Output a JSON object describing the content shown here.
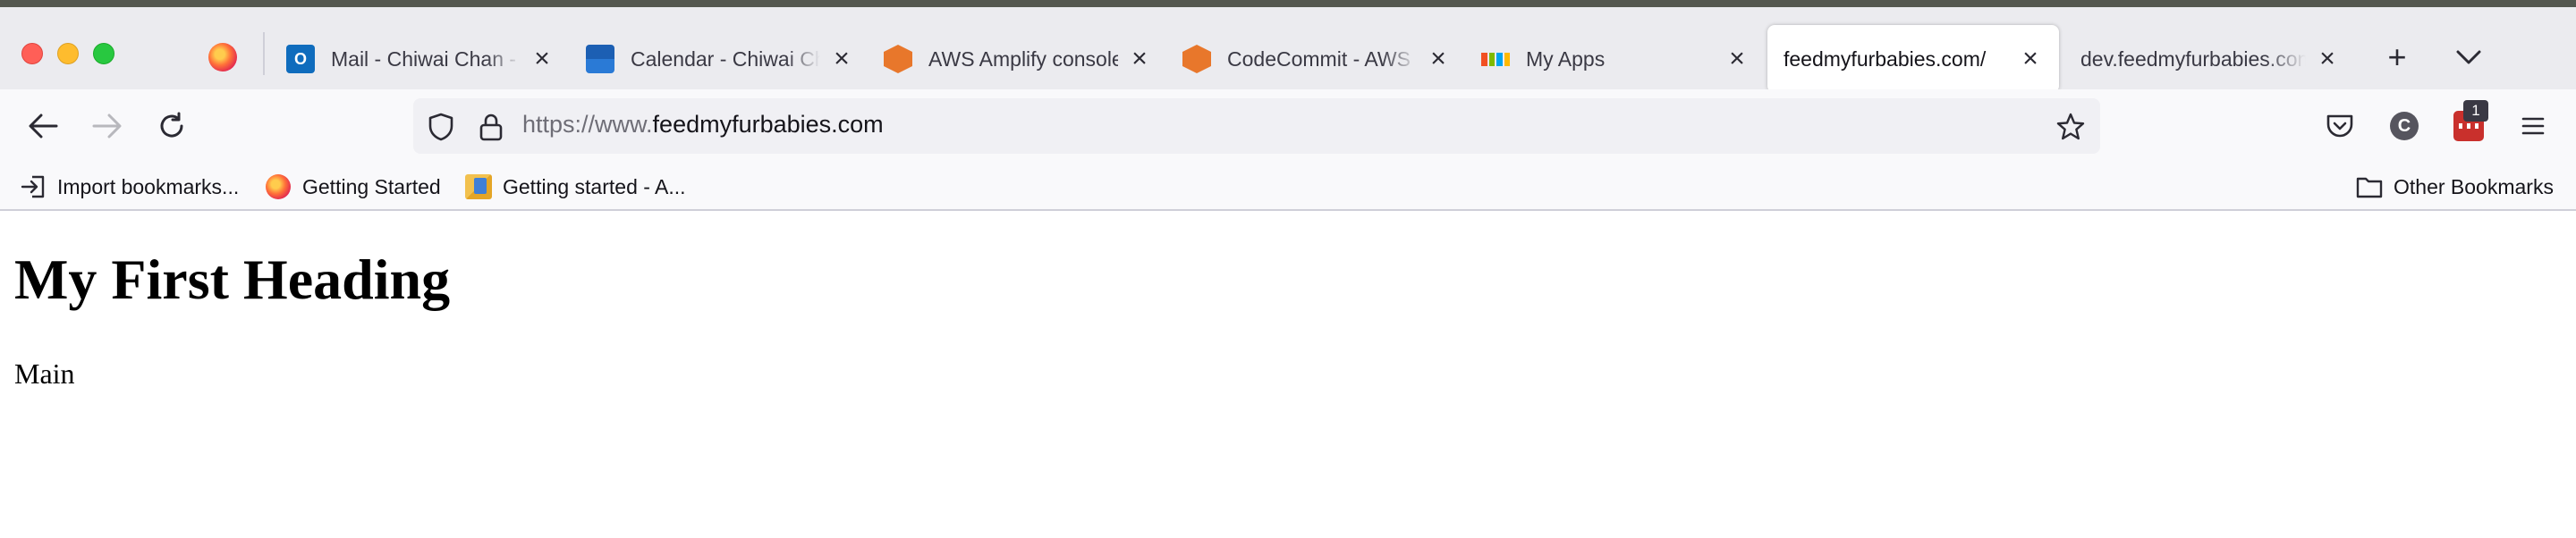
{
  "tabs": [
    {
      "label": "Mail - Chiwai Chan - Outlook",
      "icon": "outlook-icon"
    },
    {
      "label": "Calendar - Chiwai Chan - Outlook",
      "icon": "calendar-icon"
    },
    {
      "label": "AWS Amplify console",
      "icon": "aws-icon"
    },
    {
      "label": "CodeCommit - AWS Developer Tools",
      "icon": "aws-icon"
    },
    {
      "label": "My Apps",
      "icon": "microsoft-icon"
    },
    {
      "label": "feedmyfurbabies.com/",
      "icon": "none",
      "active": true
    },
    {
      "label": "dev.feedmyfurbabies.com/",
      "icon": "none"
    }
  ],
  "tab_close_glyph": "×",
  "new_tab_glyph": "+",
  "tab_list_glyph": "⌄",
  "nav": {
    "back_glyph": "←",
    "forward_glyph": "→",
    "reload_glyph": "↻"
  },
  "url": {
    "scheme": "https://www.",
    "host": "feedmyfurbabies.com"
  },
  "toolbar": {
    "bookmark_star_glyph": "☆",
    "account_initial": "C",
    "extension_badge": "1",
    "menu_glyph": "≡"
  },
  "bookmarks": [
    {
      "label": "Import bookmarks...",
      "icon": "import-icon"
    },
    {
      "label": "Getting Started",
      "icon": "firefox-icon"
    },
    {
      "label": "Getting started - A...",
      "icon": "package-icon"
    }
  ],
  "other_bookmarks": "Other Bookmarks",
  "page": {
    "heading": "My First Heading",
    "paragraph": "Main"
  },
  "colors": {
    "close_traffic": "#ff5f57",
    "minimize_traffic": "#febc2e",
    "maximize_traffic": "#28c840",
    "tabstrip_bg": "#ebebef",
    "toolbar_bg": "#f9f9fb",
    "urlbar_bg": "#f0f0f4",
    "extension_red": "#c9302c"
  }
}
